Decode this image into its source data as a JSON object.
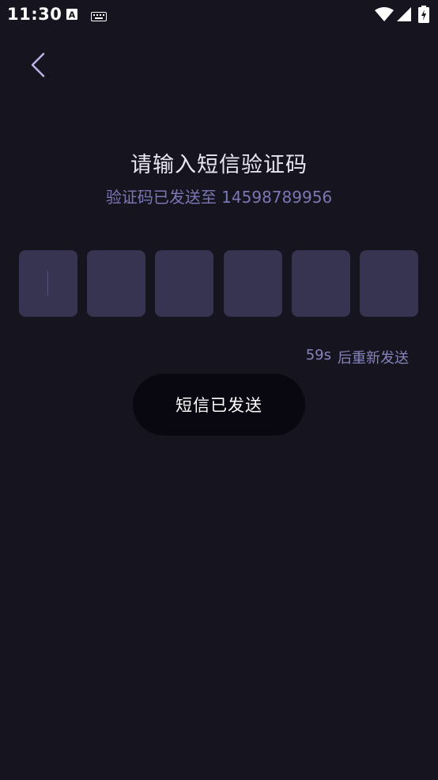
{
  "status_bar": {
    "time": "11:30",
    "icons": [
      "font-a-icon",
      "keyboard-icon",
      "wifi-icon",
      "signal-icon",
      "battery-icon"
    ]
  },
  "header": {
    "back_icon": "chevron-left-icon"
  },
  "main": {
    "title": "请输入短信验证码",
    "subtitle": "验证码已发送至 14598789956",
    "code_boxes": [
      "",
      "",
      "",
      "",
      "",
      ""
    ],
    "resend": {
      "countdown": "59s",
      "label": "后重新发送"
    },
    "submit_label": "短信已发送"
  },
  "colors": {
    "background": "#15141f",
    "box": "#363450",
    "accent_text": "#7a77b3",
    "button": "#090811"
  }
}
